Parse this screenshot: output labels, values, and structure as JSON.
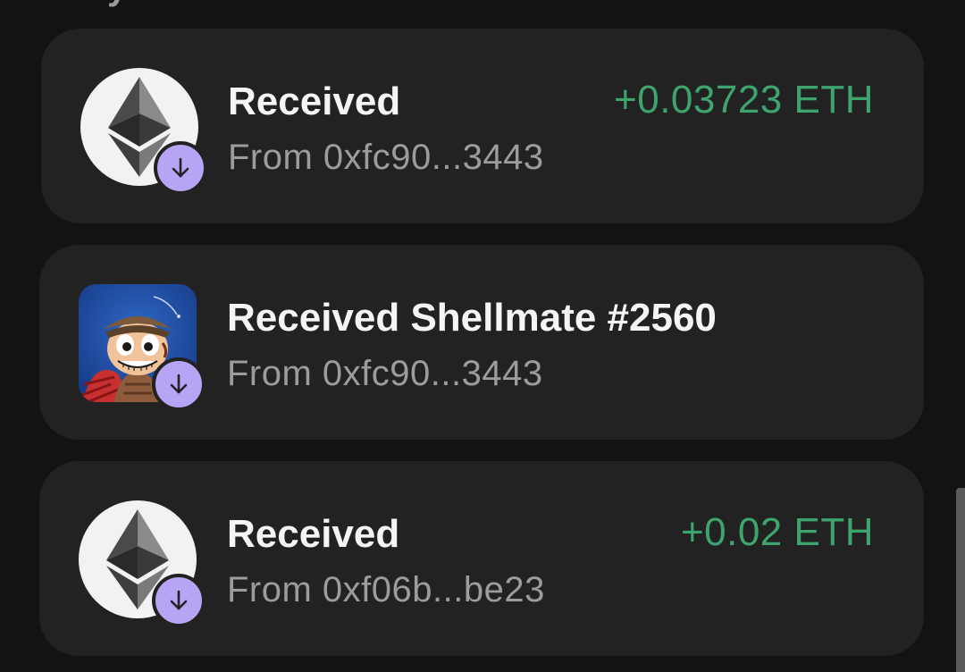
{
  "header": {
    "partial_title": "y"
  },
  "transactions": [
    {
      "title": "Received",
      "from": "From 0xfc90...3443",
      "amount": "+0.03723 ETH",
      "asset_icon": "ethereum-icon",
      "direction_icon": "arrow-down-icon"
    },
    {
      "title": "Received Shellmate #2560",
      "from": "From 0xfc90...3443",
      "amount": "",
      "asset_icon": "nft-shellmate-image",
      "direction_icon": "arrow-down-icon"
    },
    {
      "title": "Received",
      "from": "From 0xf06b...be23",
      "amount": "+0.02 ETH",
      "asset_icon": "ethereum-icon",
      "direction_icon": "arrow-down-icon"
    }
  ],
  "colors": {
    "background": "#131313",
    "card": "#222222",
    "positive_amount": "#3ea46e",
    "badge": "#b7a4f5"
  }
}
